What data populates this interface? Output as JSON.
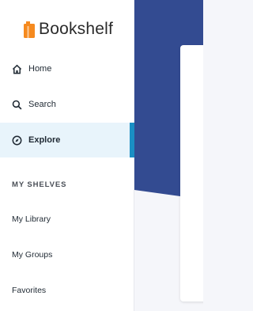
{
  "brand": {
    "name": "Bookshelf",
    "icon": "book-icon",
    "accent": "#f58a1f"
  },
  "nav": {
    "home": {
      "label": "Home",
      "icon": "home-icon"
    },
    "search": {
      "label": "Search",
      "icon": "search-icon"
    },
    "explore": {
      "label": "Explore",
      "icon": "compass-icon",
      "active": true
    }
  },
  "shelves": {
    "heading": "MY SHELVES",
    "items": [
      "My Library",
      "My Groups",
      "Favorites"
    ]
  },
  "colors": {
    "hero": "#334b91",
    "active_bg": "#e8f4fb",
    "active_bar": "#1a8fc4"
  }
}
